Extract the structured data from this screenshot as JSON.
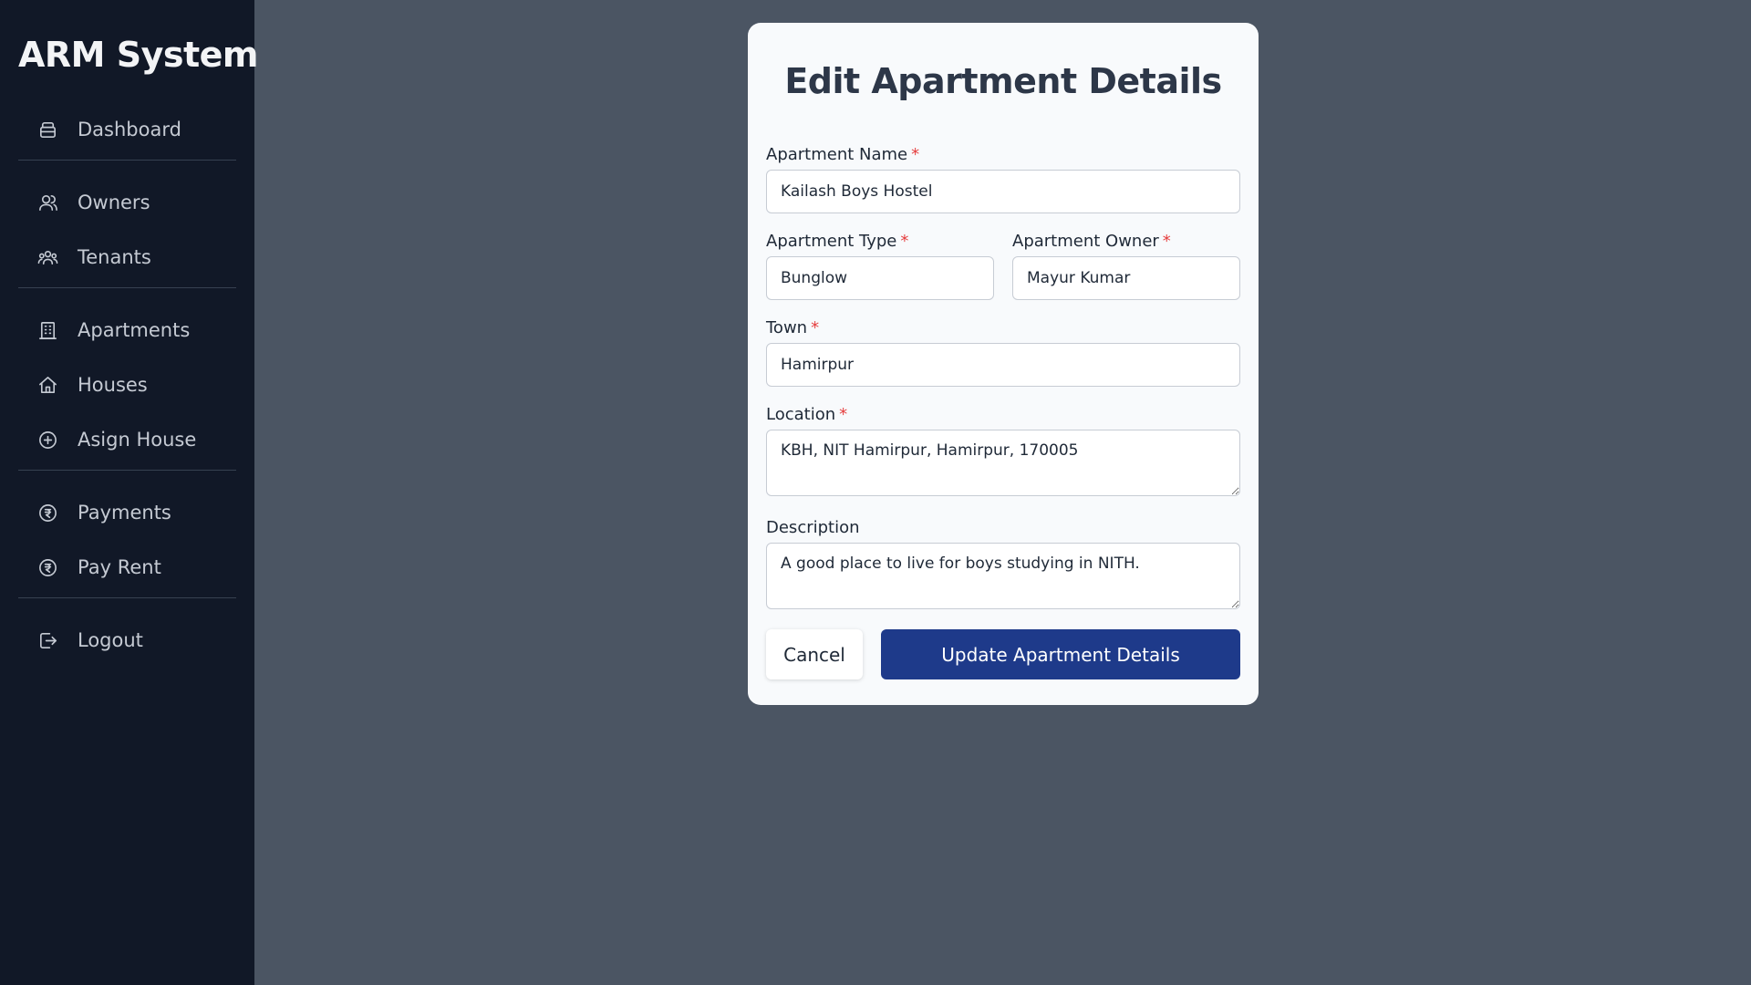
{
  "app": {
    "brand": "ARM System"
  },
  "sidebar": {
    "items": [
      {
        "label": "Dashboard",
        "icon": "dashboard-icon"
      },
      {
        "label": "Owners",
        "icon": "owners-icon"
      },
      {
        "label": "Tenants",
        "icon": "tenants-icon"
      },
      {
        "label": "Apartments",
        "icon": "building-icon"
      },
      {
        "label": "Houses",
        "icon": "home-icon"
      },
      {
        "label": "Asign House",
        "icon": "plus-circle-icon"
      },
      {
        "label": "Payments",
        "icon": "rupee-circle-icon"
      },
      {
        "label": "Pay Rent",
        "icon": "rupee-circle-icon"
      },
      {
        "label": "Logout",
        "icon": "logout-icon"
      }
    ]
  },
  "modal": {
    "title": "Edit Apartment Details",
    "required_mark": "*",
    "fields": {
      "name": {
        "label": "Apartment Name",
        "value": "Kailash Boys Hostel"
      },
      "type": {
        "label": "Apartment Type",
        "value": "Bunglow"
      },
      "owner": {
        "label": "Apartment Owner",
        "value": "Mayur Kumar"
      },
      "town": {
        "label": "Town",
        "value": "Hamirpur"
      },
      "location": {
        "label": "Location",
        "value": "KBH, NIT Hamirpur, Hamirpur, 170005"
      },
      "description": {
        "label": "Description",
        "value": "A good place to live for boys studying in NITH."
      }
    },
    "cancel_label": "Cancel",
    "submit_label": "Update Apartment Details"
  },
  "colors": {
    "sidebar_bg": "#111827",
    "page_bg": "#4b5563",
    "primary": "#1e3a8a",
    "required": "#e53e3e"
  }
}
